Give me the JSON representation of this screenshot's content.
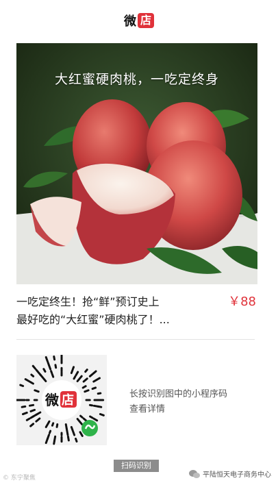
{
  "header": {
    "logo_text_part1": "微",
    "logo_text_part2": "店",
    "brand_color": "#e0323a"
  },
  "hero": {
    "caption": "大红蜜硬肉桃，一吃定终身"
  },
  "product": {
    "title_line1": "一吃定终生！抢“鲜”预订史上",
    "title_line2": "最好吃的“大红蜜”硬肉桃了！...",
    "price": "￥88",
    "price_color": "#e0323a"
  },
  "qr": {
    "center_logo_part1": "微",
    "center_logo_part2": "店",
    "hint_line1": "长按识别图中的小程序码",
    "hint_line2": "查看详情"
  },
  "footer": {
    "scan_label": "扫码识别",
    "watermark_left": "© 东宁聚焦",
    "watermark_right": "平陆恒天电子商务中心",
    "watermark_icon": "wechat-icon"
  }
}
